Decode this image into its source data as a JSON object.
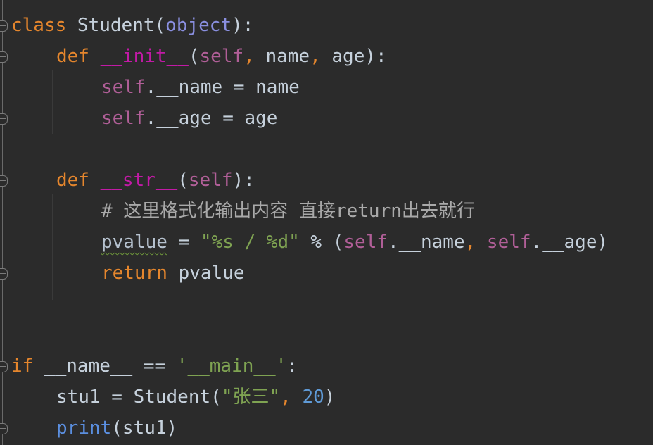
{
  "editor": {
    "language": "python",
    "lines": [
      {
        "tokens": [
          {
            "t": "class",
            "k": "kw"
          },
          {
            "t": " Student(",
            "k": "cls"
          },
          {
            "t": "object",
            "k": "builtin"
          },
          {
            "t": "):",
            "k": "plain"
          }
        ]
      },
      {
        "tokens": [
          {
            "t": "def",
            "k": "kw"
          },
          {
            "t": " ",
            "k": "plain"
          },
          {
            "t": "__init__",
            "k": "magic"
          },
          {
            "t": "(",
            "k": "plain"
          },
          {
            "t": "self",
            "k": "self"
          },
          {
            "t": ",",
            "k": "comma"
          },
          {
            "t": " name",
            "k": "plain"
          },
          {
            "t": ",",
            "k": "comma"
          },
          {
            "t": " age):",
            "k": "plain"
          }
        ]
      },
      {
        "tokens": [
          {
            "t": "self",
            "k": "self"
          },
          {
            "t": ".__name = name",
            "k": "plain"
          }
        ]
      },
      {
        "tokens": [
          {
            "t": "self",
            "k": "self"
          },
          {
            "t": ".__age = age",
            "k": "plain"
          }
        ]
      },
      {
        "tokens": []
      },
      {
        "tokens": [
          {
            "t": "def",
            "k": "kw"
          },
          {
            "t": " ",
            "k": "plain"
          },
          {
            "t": "__str__",
            "k": "magic"
          },
          {
            "t": "(",
            "k": "plain"
          },
          {
            "t": "self",
            "k": "self"
          },
          {
            "t": "):",
            "k": "plain"
          }
        ]
      },
      {
        "tokens": [
          {
            "t": "# 这里格式化输出内容 直接return出去就行",
            "k": "comment"
          }
        ]
      },
      {
        "tokens": [
          {
            "t": "pvalue",
            "k": "warn"
          },
          {
            "t": " = ",
            "k": "plain"
          },
          {
            "t": "\"%s / %d\"",
            "k": "str"
          },
          {
            "t": " % (",
            "k": "plain"
          },
          {
            "t": "self",
            "k": "self"
          },
          {
            "t": ".__name",
            "k": "plain"
          },
          {
            "t": ",",
            "k": "comma"
          },
          {
            "t": " ",
            "k": "plain"
          },
          {
            "t": "self",
            "k": "self"
          },
          {
            "t": ".__age)",
            "k": "plain"
          }
        ]
      },
      {
        "tokens": [
          {
            "t": "return",
            "k": "kw"
          },
          {
            "t": " pvalue",
            "k": "plain"
          }
        ]
      },
      {
        "tokens": []
      },
      {
        "tokens": []
      },
      {
        "tokens": [
          {
            "t": "if",
            "k": "kw"
          },
          {
            "t": " __name__ == ",
            "k": "plain"
          },
          {
            "t": "'__main__'",
            "k": "str"
          },
          {
            "t": ":",
            "k": "plain"
          }
        ]
      },
      {
        "tokens": [
          {
            "t": "stu1 = Student(",
            "k": "plain"
          },
          {
            "t": "\"张三\"",
            "k": "str"
          },
          {
            "t": ",",
            "k": "comma"
          },
          {
            "t": " ",
            "k": "plain"
          },
          {
            "t": "20",
            "k": "num"
          },
          {
            "t": ")",
            "k": "plain"
          }
        ]
      },
      {
        "tokens": [
          {
            "t": "print",
            "k": "fn"
          },
          {
            "t": "(stu1)",
            "k": "plain"
          }
        ]
      }
    ]
  }
}
